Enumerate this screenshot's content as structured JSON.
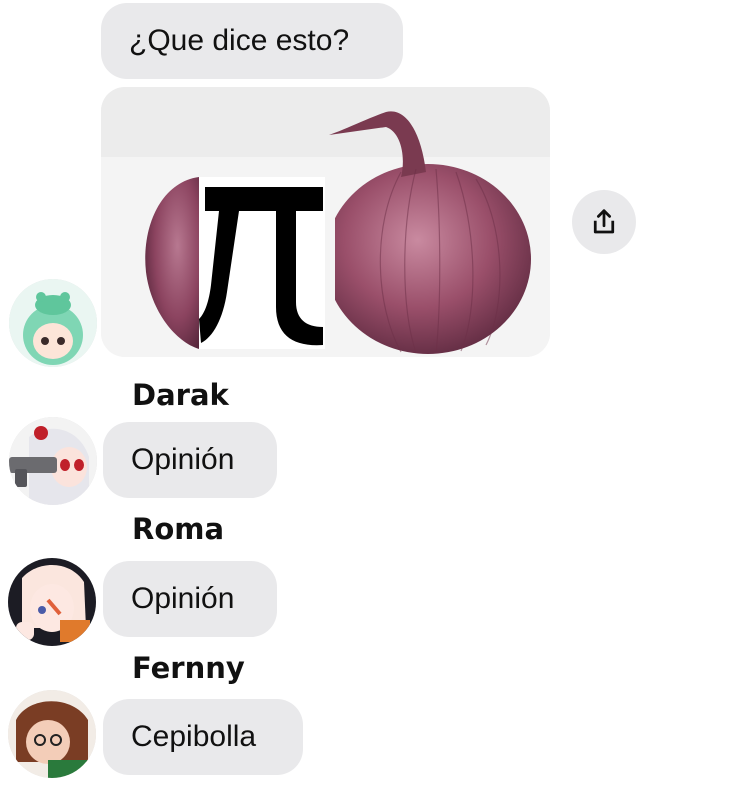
{
  "chat": {
    "question": "¿Que dice esto?",
    "image_description_icon": "onion-pi-image",
    "share_icon": "share-icon",
    "replies": [
      {
        "sender": "Darak",
        "text": "Opinión",
        "avatar": "avatar-gun-girl"
      },
      {
        "sender": "Roma",
        "text": "Opinión",
        "avatar": "avatar-white-hair"
      },
      {
        "sender": "Fernny",
        "text": "Cepibolla",
        "avatar": "avatar-brown-hair"
      }
    ]
  },
  "colors": {
    "bubble": "#e9e9eb",
    "onion": "#9a4f6a",
    "pi": "#000000"
  }
}
